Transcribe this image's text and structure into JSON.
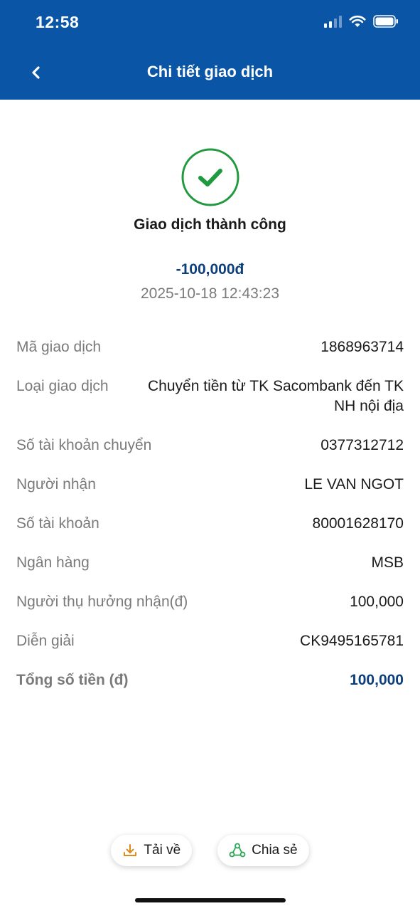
{
  "status_bar": {
    "time": "12:58"
  },
  "header": {
    "title": "Chi tiết giao dịch"
  },
  "result": {
    "status": "Giao dịch thành công",
    "amount": "-100,000đ",
    "datetime": "2025-10-18 12:43:23"
  },
  "details": {
    "rows": [
      {
        "label": "Mã giao dịch",
        "value": "1868963714"
      },
      {
        "label": "Loại giao dịch",
        "value": "Chuyển tiền từ TK Sacombank đến TK NH nội địa"
      },
      {
        "label": "Số tài khoản chuyển",
        "value": "0377312712"
      },
      {
        "label": "Người nhận",
        "value": "LE VAN NGOT"
      },
      {
        "label": "Số tài khoản",
        "value": "80001628170"
      },
      {
        "label": "Ngân hàng",
        "value": "MSB"
      },
      {
        "label": "Người thụ hưởng nhận(đ)",
        "value": "100,000"
      },
      {
        "label": "Diễn giải",
        "value": "CK9495165781"
      }
    ],
    "total": {
      "label": "Tổng số tiền (đ)",
      "value": "100,000"
    }
  },
  "actions": {
    "download_label": "Tải về",
    "share_label": "Chia sẻ"
  },
  "icons": {
    "back": "chevron-left-icon",
    "success": "check-circle-icon",
    "download": "download-icon",
    "share": "share-icon",
    "signal": "cellular-signal-icon",
    "wifi": "wifi-icon",
    "battery": "battery-icon"
  },
  "colors": {
    "header_bg": "#0a55a6",
    "success_green": "#1f9a3f",
    "amount_blue": "#0d3f7c",
    "download_orange": "#e08a1e",
    "share_green": "#2aa552"
  }
}
